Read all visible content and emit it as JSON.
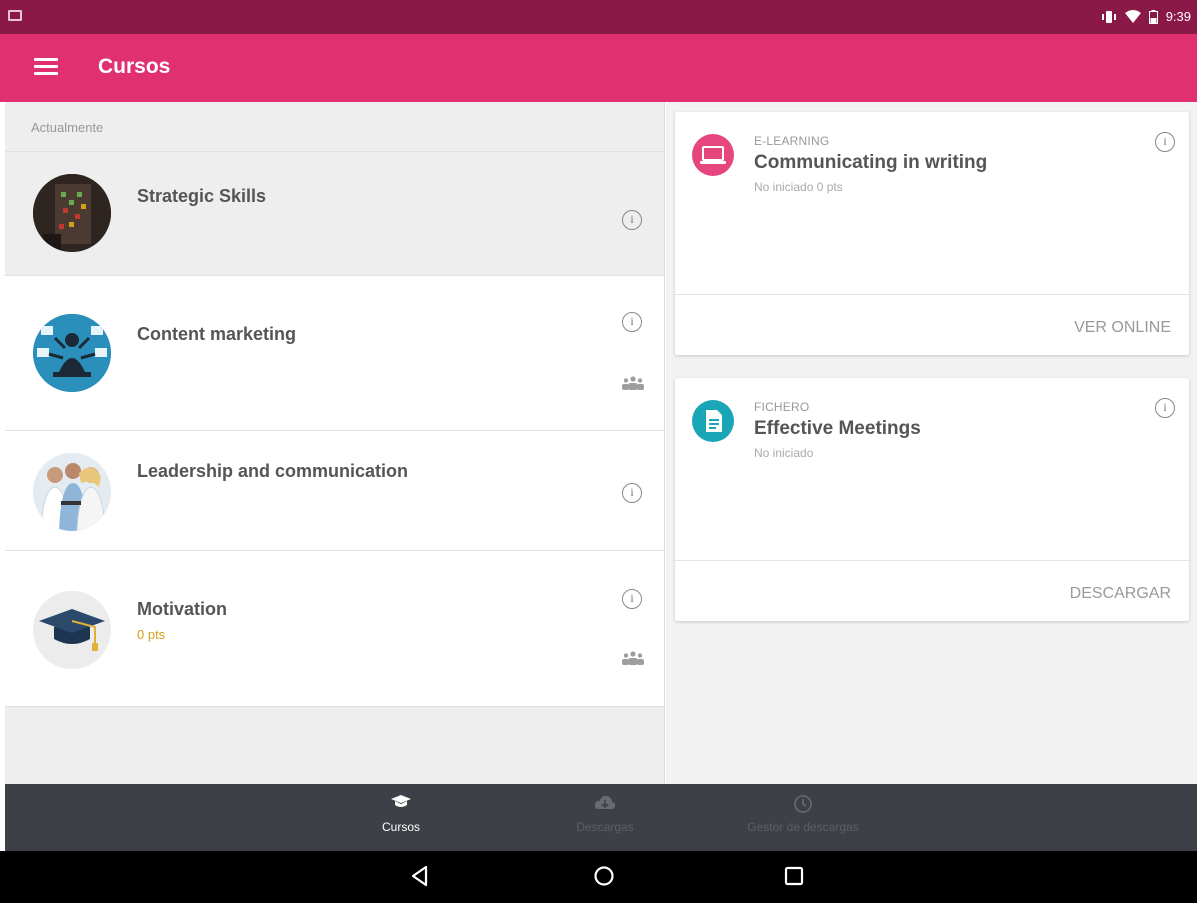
{
  "status_bar": {
    "time": "9:39"
  },
  "app_bar": {
    "title": "Cursos"
  },
  "courses_section": {
    "label": "Actualmente"
  },
  "courses": [
    {
      "name": "Strategic Skills",
      "pts": ""
    },
    {
      "name": "Content marketing",
      "pts": ""
    },
    {
      "name": "Leadership and communication",
      "pts": ""
    },
    {
      "name": "Motivation",
      "pts": "0 pts"
    }
  ],
  "cards": [
    {
      "type": "E-LEARNING",
      "title": "Communicating in writing",
      "status": "No iniciado  0 pts",
      "action": "VER ONLINE",
      "icon": "laptop-icon"
    },
    {
      "type": "FICHERO",
      "title": "Effective Meetings",
      "status": "No iniciado",
      "action": "DESCARGAR",
      "icon": "document-icon"
    }
  ],
  "bottom_nav": [
    {
      "label": "Cursos",
      "icon": "graduation-cap-icon"
    },
    {
      "label": "Descargas",
      "icon": "cloud-download-icon"
    },
    {
      "label": "Gestor de descargas",
      "icon": "clock-icon"
    }
  ],
  "colors": {
    "accent": "#e0306f",
    "status_bar": "#8a1947",
    "nav": "#3e4047",
    "pts": "#d4a017",
    "elearning": "#e5467e",
    "file": "#1aa6b7"
  }
}
